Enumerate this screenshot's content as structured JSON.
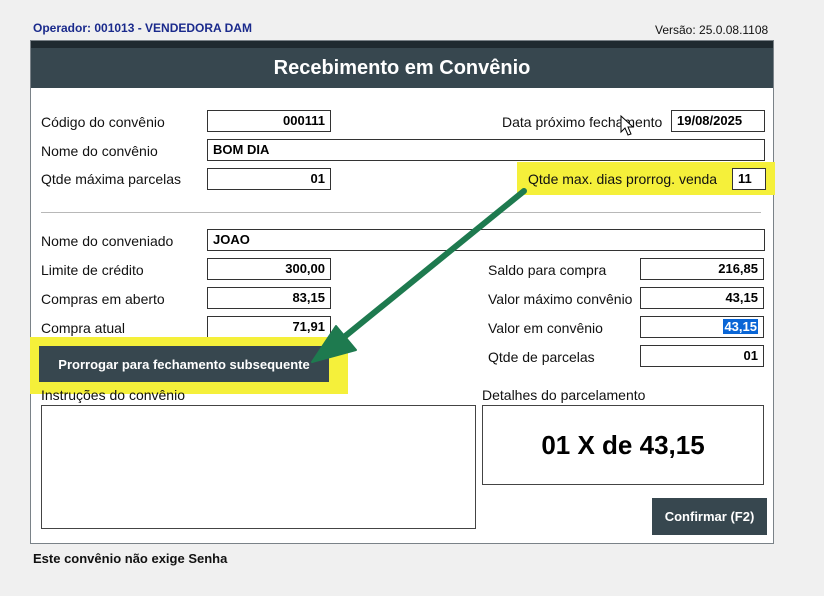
{
  "header": {
    "operator": "Operador: 001013 - VENDEDORA DAM",
    "version": "Versão: 25.0.08.1108"
  },
  "window": {
    "title": "Recebimento em Convênio"
  },
  "convenio": {
    "codigo_label": "Código do convênio",
    "codigo_value": "000111",
    "nome_label": "Nome do convênio",
    "nome_value": "BOM DIA",
    "parcelas_label": "Qtde máxima parcelas",
    "parcelas_value": "01",
    "fechamento_label": "Data próximo fechamento",
    "fechamento_value": "19/08/2025",
    "prorrog_label": "Qtde max. dias prorrog. venda",
    "prorrog_value": "11"
  },
  "conveniado": {
    "nome_label": "Nome do conveniado",
    "nome_value": "JOAO",
    "limite_label": "Limite de crédito",
    "limite_value": "300,00",
    "compras_aberto_label": "Compras em aberto",
    "compras_aberto_value": "83,15",
    "compra_atual_label": "Compra atual",
    "compra_atual_value": "71,91",
    "saldo_label": "Saldo para compra",
    "saldo_value": "216,85",
    "valor_max_label": "Valor máximo convênio",
    "valor_max_value": "43,15",
    "valor_conv_label": "Valor em convênio",
    "valor_conv_value": "43,15",
    "qtde_parcelas_label": "Qtde de parcelas",
    "qtde_parcelas_value": "01"
  },
  "actions": {
    "prorrogar_label": "Prorrogar para fechamento subsequente",
    "confirmar_label": "Confirmar (F2)"
  },
  "instrucoes": {
    "label": "Instruções do convênio",
    "value": ""
  },
  "detalhes": {
    "label": "Detalhes do parcelamento",
    "value": "01 X de 43,15"
  },
  "footer": {
    "text": "Este convênio não exige Senha"
  },
  "colors": {
    "titlebar": "#37474f",
    "highlight": "#f5f03a",
    "arrow": "#1e7a4f",
    "operator_text": "#1a2a8c"
  }
}
